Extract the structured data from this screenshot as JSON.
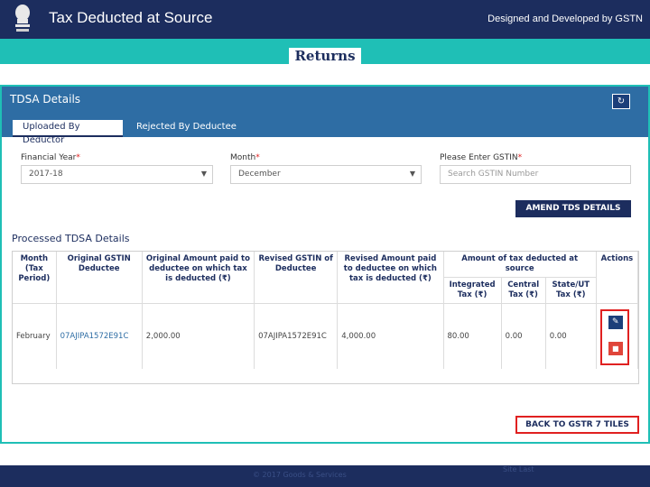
{
  "header": {
    "title": "Tax Deducted at Source",
    "credit": "Designed and Developed by GSTN",
    "logo_icon": "state-emblem-icon"
  },
  "page": {
    "heading": "Returns"
  },
  "panel": {
    "title": "TDSA Details",
    "tabs": [
      {
        "label": "Uploaded By Deductor",
        "active": true
      },
      {
        "label": "Rejected By Deductee",
        "active": false
      }
    ],
    "filters": {
      "financial_year": {
        "label": "Financial Year",
        "value": "2017-18"
      },
      "month": {
        "label": "Month",
        "value": "December"
      },
      "gstin": {
        "label": "Please Enter GSTIN",
        "placeholder": "Search GSTIN Number"
      }
    },
    "amend_button": "AMEND TDS DETAILS",
    "section_title": "Processed TDSA Details",
    "table": {
      "headers": {
        "month": "Month (Tax Period)",
        "orig_gstin": "Original GSTIN Deductee",
        "orig_amount": "Original Amount paid to deductee on which tax is deducted (₹)",
        "rev_gstin": "Revised GSTIN of Deductee",
        "rev_amount": "Revised Amount paid to deductee on which tax is deducted (₹)",
        "tax_group": "Amount of tax deducted at source",
        "integrated": "Integrated Tax (₹)",
        "central": "Central Tax (₹)",
        "state": "State/UT Tax (₹)",
        "actions": "Actions"
      },
      "rows": [
        {
          "month": "February",
          "orig_gstin": "07AJIPA1572E91C",
          "orig_amount": "2,000.00",
          "rev_gstin": "07AJIPA1572E91C",
          "rev_amount": "4,000.00",
          "integrated": "80.00",
          "central": "0.00",
          "state": "0.00"
        }
      ]
    },
    "back_button": "BACK TO GSTR 7 TILES"
  },
  "footer": {
    "left": "© 2017 Goods & Services",
    "right": "Site Last"
  },
  "colors": {
    "navy": "#1c2d5e",
    "teal": "#1fbfb6",
    "blue": "#2e6da4",
    "red": "#e02020"
  }
}
